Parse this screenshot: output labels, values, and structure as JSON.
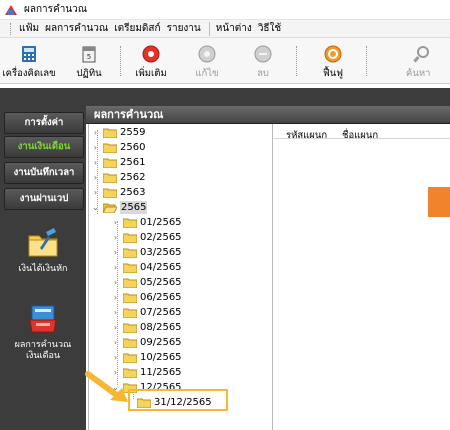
{
  "window": {
    "title": "ผลการคำนวณ"
  },
  "menu": {
    "items": [
      "แฟ้ม",
      "ผลการคำนวณ",
      "เตรียมดิสก์",
      "รายงาน",
      "หน้าต่าง",
      "วิธีใช้"
    ]
  },
  "toolbar": {
    "buttons": [
      {
        "label": "เครื่องคิดเลข",
        "icon": "calculator-icon",
        "enabled": true
      },
      {
        "label": "ปฏิทิน",
        "icon": "calendar-icon",
        "enabled": true
      },
      {
        "label": "เพิ่มเติม",
        "icon": "add-icon",
        "enabled": true
      },
      {
        "label": "แก้ไข",
        "icon": "edit-icon",
        "enabled": false
      },
      {
        "label": "ลบ",
        "icon": "delete-icon",
        "enabled": false
      },
      {
        "label": "ฟื้นฟู",
        "icon": "refresh-icon",
        "enabled": true
      },
      {
        "label": "ค้นหา",
        "icon": "search-icon",
        "enabled": false
      }
    ]
  },
  "leftnav": {
    "buttons": [
      {
        "label": "การตั้งค่า",
        "active": false
      },
      {
        "label": "งานเงินเดือน",
        "active": true
      },
      {
        "label": "งานบันทึกเวลา",
        "active": false
      },
      {
        "label": "งานผ่านเวป",
        "active": false
      }
    ],
    "icons": [
      {
        "label": "เงินได้เงินหัก",
        "icon": "folder-edit-icon"
      },
      {
        "label": "ผลการคำนวณเงินเดือน",
        "label_line1": "ผลการคำนวณ",
        "label_line2": "เงินเดือน",
        "icon": "calculation-result-icon"
      }
    ]
  },
  "main": {
    "header": "ผลการคำนวณ",
    "tree": {
      "years": [
        "2559",
        "2560",
        "2561",
        "2562",
        "2563",
        "2565"
      ],
      "expanded_year": "2565",
      "months": [
        "01/2565",
        "02/2565",
        "03/2565",
        "04/2565",
        "05/2565",
        "06/2565",
        "07/2565",
        "08/2565",
        "09/2565",
        "10/2565",
        "11/2565",
        "12/2565"
      ],
      "expanded_month": "12/2565",
      "date_node": "31/12/2565"
    },
    "list": {
      "columns": [
        "รหัสแผนก",
        "ชื่อแผนก"
      ]
    }
  },
  "colors": {
    "nav_bg": "#3c3c3c",
    "nav_active_text": "#7cd838",
    "highlight_border": "#f7b733",
    "arrow": "#f7b733",
    "accent_orange": "#f0832c",
    "folder": "#f5d35c"
  }
}
